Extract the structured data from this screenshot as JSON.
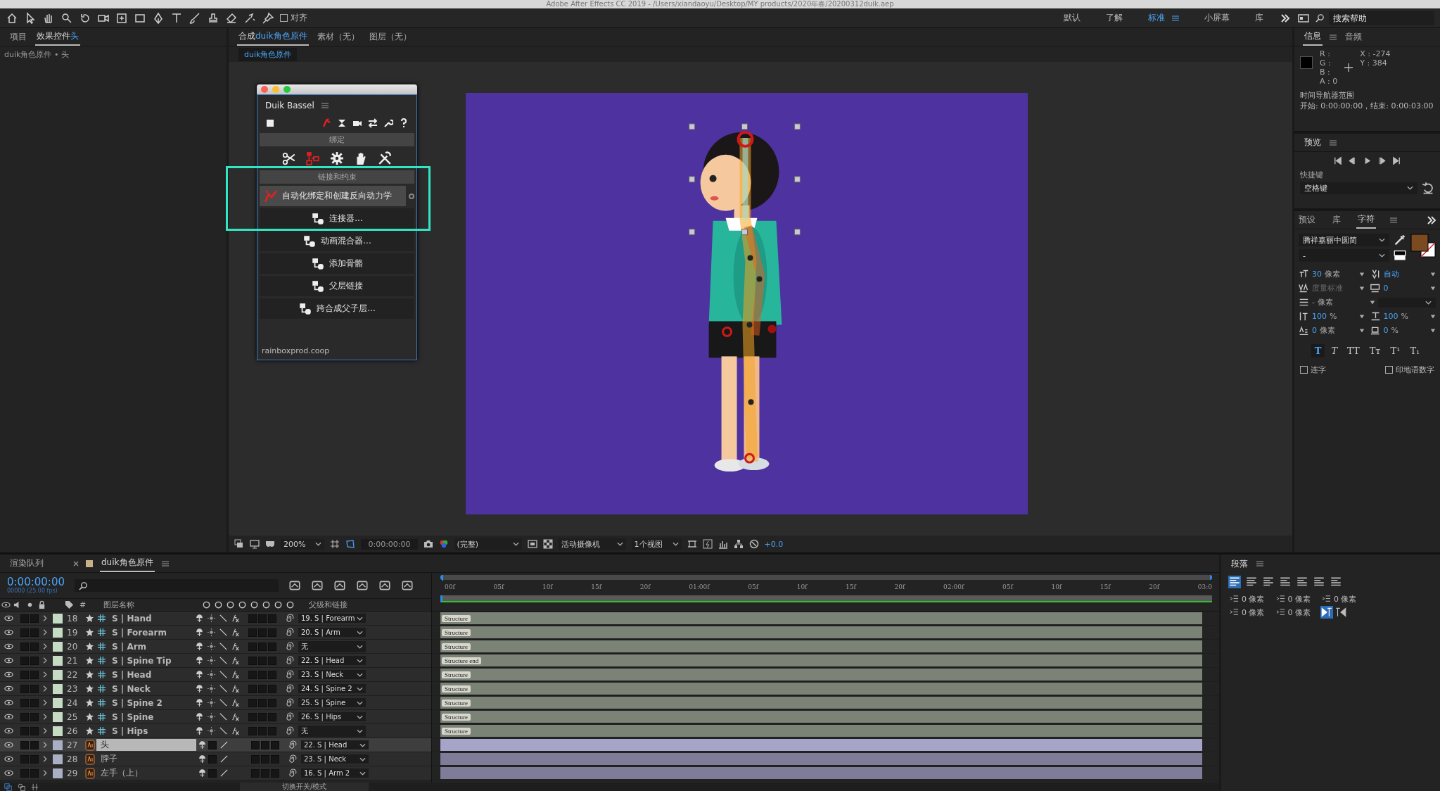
{
  "title_bar": "Adobe After Effects CC 2019 - /Users/xiandaoyu/Desktop/MY products/2020年春/20200312duik.aep",
  "toolbar": {
    "snap": {
      "label": "对齐",
      "checked": false
    },
    "workspaces": [
      {
        "label": "默认",
        "selected": false
      },
      {
        "label": "了解",
        "selected": false
      },
      {
        "label": "标准",
        "selected": true
      },
      {
        "label": "小屏幕",
        "selected": false
      },
      {
        "label": "库",
        "selected": false
      }
    ],
    "search_placeholder": "搜索帮助"
  },
  "project_panel": {
    "tabs": [
      {
        "label": "项目",
        "selected": false
      },
      {
        "label": "效果控件",
        "layer": "头",
        "selected": true
      }
    ],
    "breadcrumb": "duik角色原件 • 头"
  },
  "composition_panel": {
    "tabs": [
      {
        "label": "合成",
        "comp": "duik角色原件",
        "selected": true
      },
      {
        "label": "素材（无）",
        "selected": false
      },
      {
        "label": "图层（无）",
        "selected": false
      }
    ],
    "comp_chip": "duik角色原件",
    "viewer_bar": {
      "zoom": "200%",
      "timecode": "0:00:00:00",
      "resolution": "(完整)",
      "camera": "活动摄像机",
      "views": "1个视图",
      "exposure": "+0.0"
    }
  },
  "duik_panel": {
    "title": "Duik Bassel",
    "rigging_header": "绑定",
    "links_header": "链接和约束",
    "tools": [
      {
        "label": "自动化绑定和创建反向动力学",
        "selected": true
      },
      {
        "label": "连接器...",
        "selected": false
      },
      {
        "label": "动画混合器...",
        "selected": false
      },
      {
        "label": "添加骨骼",
        "selected": false
      },
      {
        "label": "父层链接",
        "selected": false
      },
      {
        "label": "跨合成父子层...",
        "selected": false
      }
    ],
    "footer": "rainboxprod.coop"
  },
  "info_panel": {
    "tabs": [
      {
        "label": "信息",
        "selected": true
      },
      {
        "label": "音频",
        "selected": false
      }
    ],
    "channels": [
      "R :",
      "G :",
      "B :",
      "A :  0"
    ],
    "x": "X : -274",
    "y": "Y : 384",
    "nav_title": "时间导航器范围",
    "nav_range": "开始: 0:00:00:00，结束: 0:00:03:00"
  },
  "preview_panel": {
    "title": "预览",
    "shortcut_label": "快捷键",
    "shortcut": "空格键"
  },
  "character_panel": {
    "tabs": [
      {
        "label": "预设",
        "selected": false
      },
      {
        "label": "库",
        "selected": false
      },
      {
        "label": "字符",
        "selected": true
      }
    ],
    "font": "腾祥嘉丽中圆简",
    "style": "-",
    "fields": [
      {
        "kind": "size",
        "value": "30",
        "unit": "像素",
        "disabled": false
      },
      {
        "kind": "leading",
        "value": "自动",
        "disabled": false
      },
      {
        "kind": "kerning",
        "value": "度量标准",
        "disabled": true
      },
      {
        "kind": "tracking",
        "value": "0",
        "disabled": false
      },
      {
        "kind": "stroke",
        "value": "-",
        "unit": "像素",
        "disabled": false
      },
      {
        "kind": "vscale",
        "value": "100",
        "unit": "%",
        "disabled": false
      },
      {
        "kind": "hscale",
        "value": "100",
        "unit": "%",
        "disabled": false
      },
      {
        "kind": "baseline",
        "value": "0",
        "unit": "像素",
        "disabled": false
      },
      {
        "kind": "tsume",
        "value": "0",
        "unit": "%",
        "disabled": false
      }
    ],
    "text_styles": [
      {
        "kind": "bold",
        "label": "T",
        "selected": true
      },
      {
        "kind": "italic",
        "label": "T",
        "selected": false
      },
      {
        "kind": "caps",
        "label": "TT",
        "selected": false
      },
      {
        "kind": "smallcaps",
        "label": "Tᴛ",
        "selected": false
      },
      {
        "kind": "super",
        "label": "T¹",
        "selected": false
      },
      {
        "kind": "sub",
        "label": "T₁",
        "selected": false
      }
    ],
    "checkboxes": [
      {
        "label": "连字",
        "checked": false
      },
      {
        "label": "印地语数字",
        "checked": false
      }
    ]
  },
  "timeline": {
    "tabs": [
      {
        "label": "渲染队列",
        "selected": false
      },
      {
        "label": "duik角色原件",
        "selected": true
      }
    ],
    "timecode": "0:00:00:00",
    "frame_info": "00000 (25.00 fps)",
    "columns": {
      "number": "#",
      "name": "图层名称",
      "parent": "父级和链接"
    },
    "ruler": [
      "00f",
      "05f",
      "10f",
      "15f",
      "20f",
      "01:00f",
      "05f",
      "10f",
      "15f",
      "20f",
      "02:00f",
      "05f",
      "10f",
      "15f",
      "20f",
      "03:0"
    ],
    "layers": [
      {
        "number": "18",
        "kind": "shape",
        "name": "S | Hand",
        "parent": "19. S | Forearm",
        "marker": "Structure",
        "color": "#c4dcc4",
        "selected": false
      },
      {
        "number": "19",
        "kind": "shape",
        "name": "S | Forearm",
        "parent": "20. S | Arm",
        "marker": "Structure",
        "color": "#c4dcc4",
        "selected": false
      },
      {
        "number": "20",
        "kind": "shape",
        "name": "S | Arm",
        "parent": "无",
        "marker": "Structure",
        "color": "#c4dcc4",
        "selected": false
      },
      {
        "number": "21",
        "kind": "shape",
        "name": "S | Spine Tip",
        "parent": "22. S | Head",
        "marker": "Structure end",
        "color": "#c4dcc4",
        "selected": false
      },
      {
        "number": "22",
        "kind": "shape",
        "name": "S | Head",
        "parent": "23. S | Neck",
        "marker": "Structure",
        "color": "#c4dcc4",
        "selected": false
      },
      {
        "number": "23",
        "kind": "shape",
        "name": "S | Neck",
        "parent": "24. S | Spine 2",
        "marker": "Structure",
        "color": "#c4dcc4",
        "selected": false
      },
      {
        "number": "24",
        "kind": "shape",
        "name": "S | Spine 2",
        "parent": "25. S | Spine",
        "marker": "Structure",
        "color": "#c4dcc4",
        "selected": false
      },
      {
        "number": "25",
        "kind": "shape",
        "name": "S | Spine",
        "parent": "26. S | Hips",
        "marker": "Structure",
        "color": "#c4dcc4",
        "selected": false
      },
      {
        "number": "26",
        "kind": "shape",
        "name": "S | Hips",
        "parent": "无",
        "marker": "Structure",
        "color": "#c4dcc4",
        "selected": false
      },
      {
        "number": "27",
        "kind": "ai",
        "name": "头",
        "parent": "22. S | Head",
        "color": "#a9b0c6",
        "selected": true
      },
      {
        "number": "28",
        "kind": "ai",
        "name": "脖子",
        "parent": "23. S | Neck",
        "color": "#a9b0c6",
        "selected": false
      },
      {
        "number": "29",
        "kind": "ai",
        "name": "左手（上）",
        "parent": "16. S | Arm 2",
        "color": "#a9b0c6",
        "selected": false
      }
    ],
    "toggle_label": "切换开关/模式"
  },
  "paragraph_panel": {
    "title": "段落",
    "fields": [
      "0 像素",
      "0 像素",
      "0 像素",
      "0 像素",
      "0 像素"
    ]
  }
}
